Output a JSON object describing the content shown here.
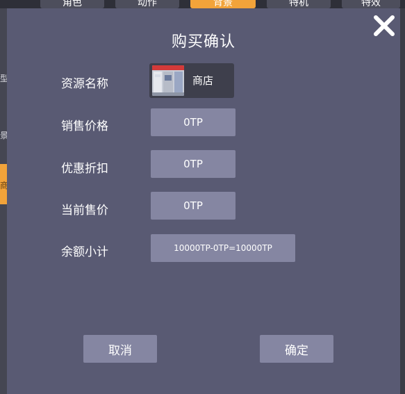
{
  "background": {
    "tabs": [
      {
        "label": "角色"
      },
      {
        "label": "动作"
      },
      {
        "label": "背景"
      },
      {
        "label": "特机"
      },
      {
        "label": "特效"
      }
    ],
    "side": {
      "item_1": "型",
      "item_2": "景",
      "item_3": "商"
    }
  },
  "dialog": {
    "title": "购买确认",
    "rows": {
      "resource_name_label": "资源名称",
      "resource_name_value": "商店",
      "sale_price_label": "销售价格",
      "sale_price_value": "0TP",
      "discount_label": "优惠折扣",
      "discount_value": "0TP",
      "current_price_label": "当前售价",
      "current_price_value": "0TP",
      "balance_label": "余额小计",
      "balance_value": "10000TP-0TP=10000TP"
    },
    "cancel_label": "取消",
    "confirm_label": "确定"
  },
  "colors": {
    "modal_bg": "#595a73",
    "value_box": "#8586a2",
    "accent_tab": "#f2a33a"
  },
  "icons": [
    "close-icon",
    "store-thumbnail"
  ]
}
